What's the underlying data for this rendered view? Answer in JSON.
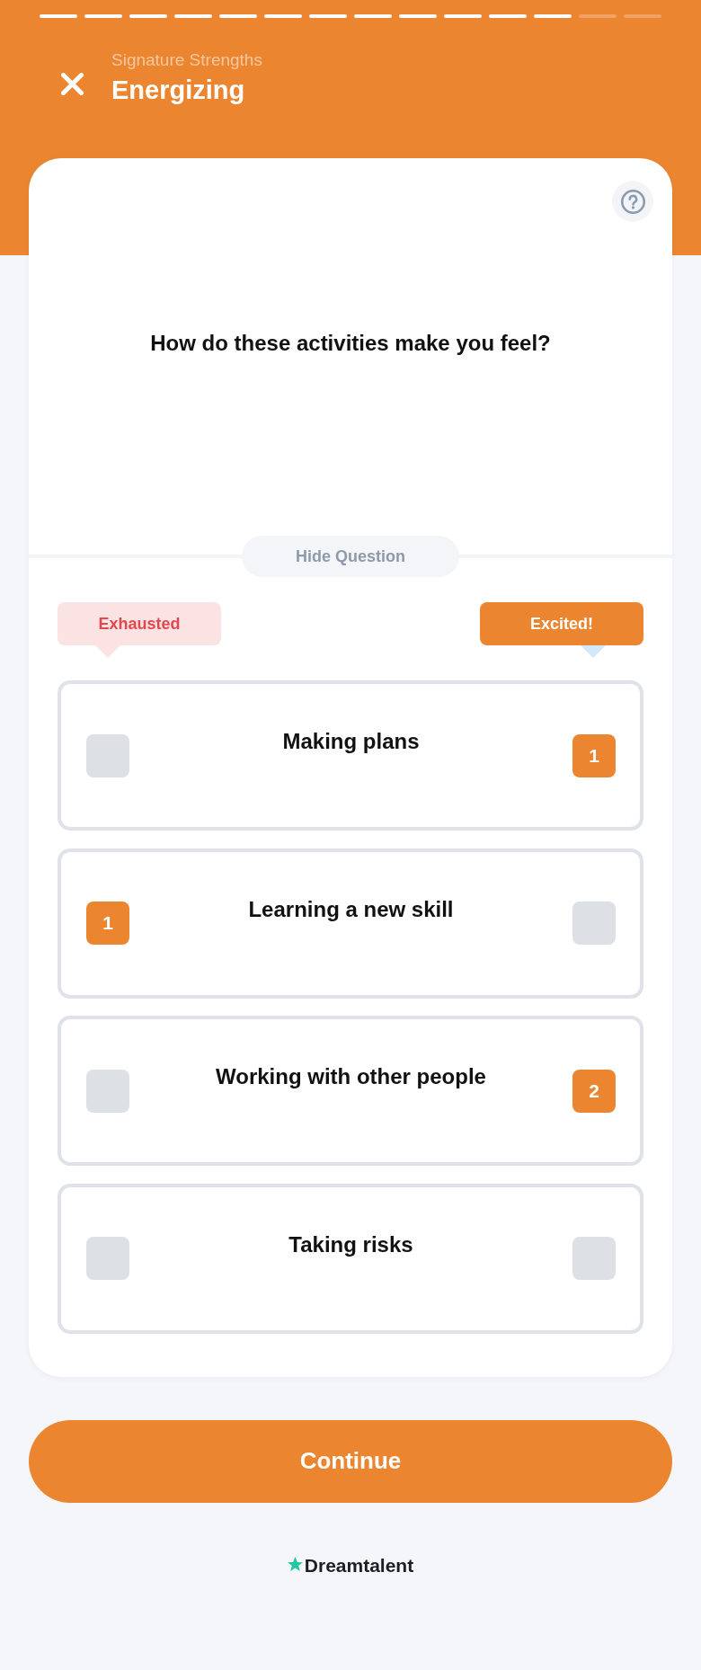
{
  "progress_steps": [
    {
      "completed": true
    },
    {
      "completed": true
    },
    {
      "completed": true
    },
    {
      "completed": true
    },
    {
      "completed": true
    },
    {
      "completed": true
    },
    {
      "completed": true
    },
    {
      "completed": true
    },
    {
      "completed": true
    },
    {
      "completed": true
    },
    {
      "completed": true
    },
    {
      "completed": true
    },
    {
      "completed": false
    },
    {
      "completed": false
    }
  ],
  "header": {
    "subtitle": "Signature Strengths",
    "title": "Energizing"
  },
  "question": {
    "text": "How do these activities make you feel?",
    "toggle_label": "Hide Question"
  },
  "scale_labels": [
    {
      "kind": "low",
      "text": "Exhausted"
    },
    {
      "kind": "high",
      "text": "Excited!"
    }
  ],
  "activities": [
    {
      "label": "Making plans",
      "exhausted": {
        "selected": false
      },
      "excited": {
        "selected": true,
        "rank": "1"
      }
    },
    {
      "label": "Learning a new skill",
      "exhausted": {
        "selected": true,
        "rank": "1"
      },
      "excited": {
        "selected": false
      }
    },
    {
      "label": "Working with other people",
      "exhausted": {
        "selected": false
      },
      "excited": {
        "selected": true,
        "rank": "2"
      }
    },
    {
      "label": "Taking risks",
      "exhausted": {
        "selected": false
      },
      "excited": {
        "selected": false
      }
    }
  ],
  "continue_button": {
    "label": "Continue"
  },
  "footer": {
    "brand": "Dreamtalent"
  }
}
